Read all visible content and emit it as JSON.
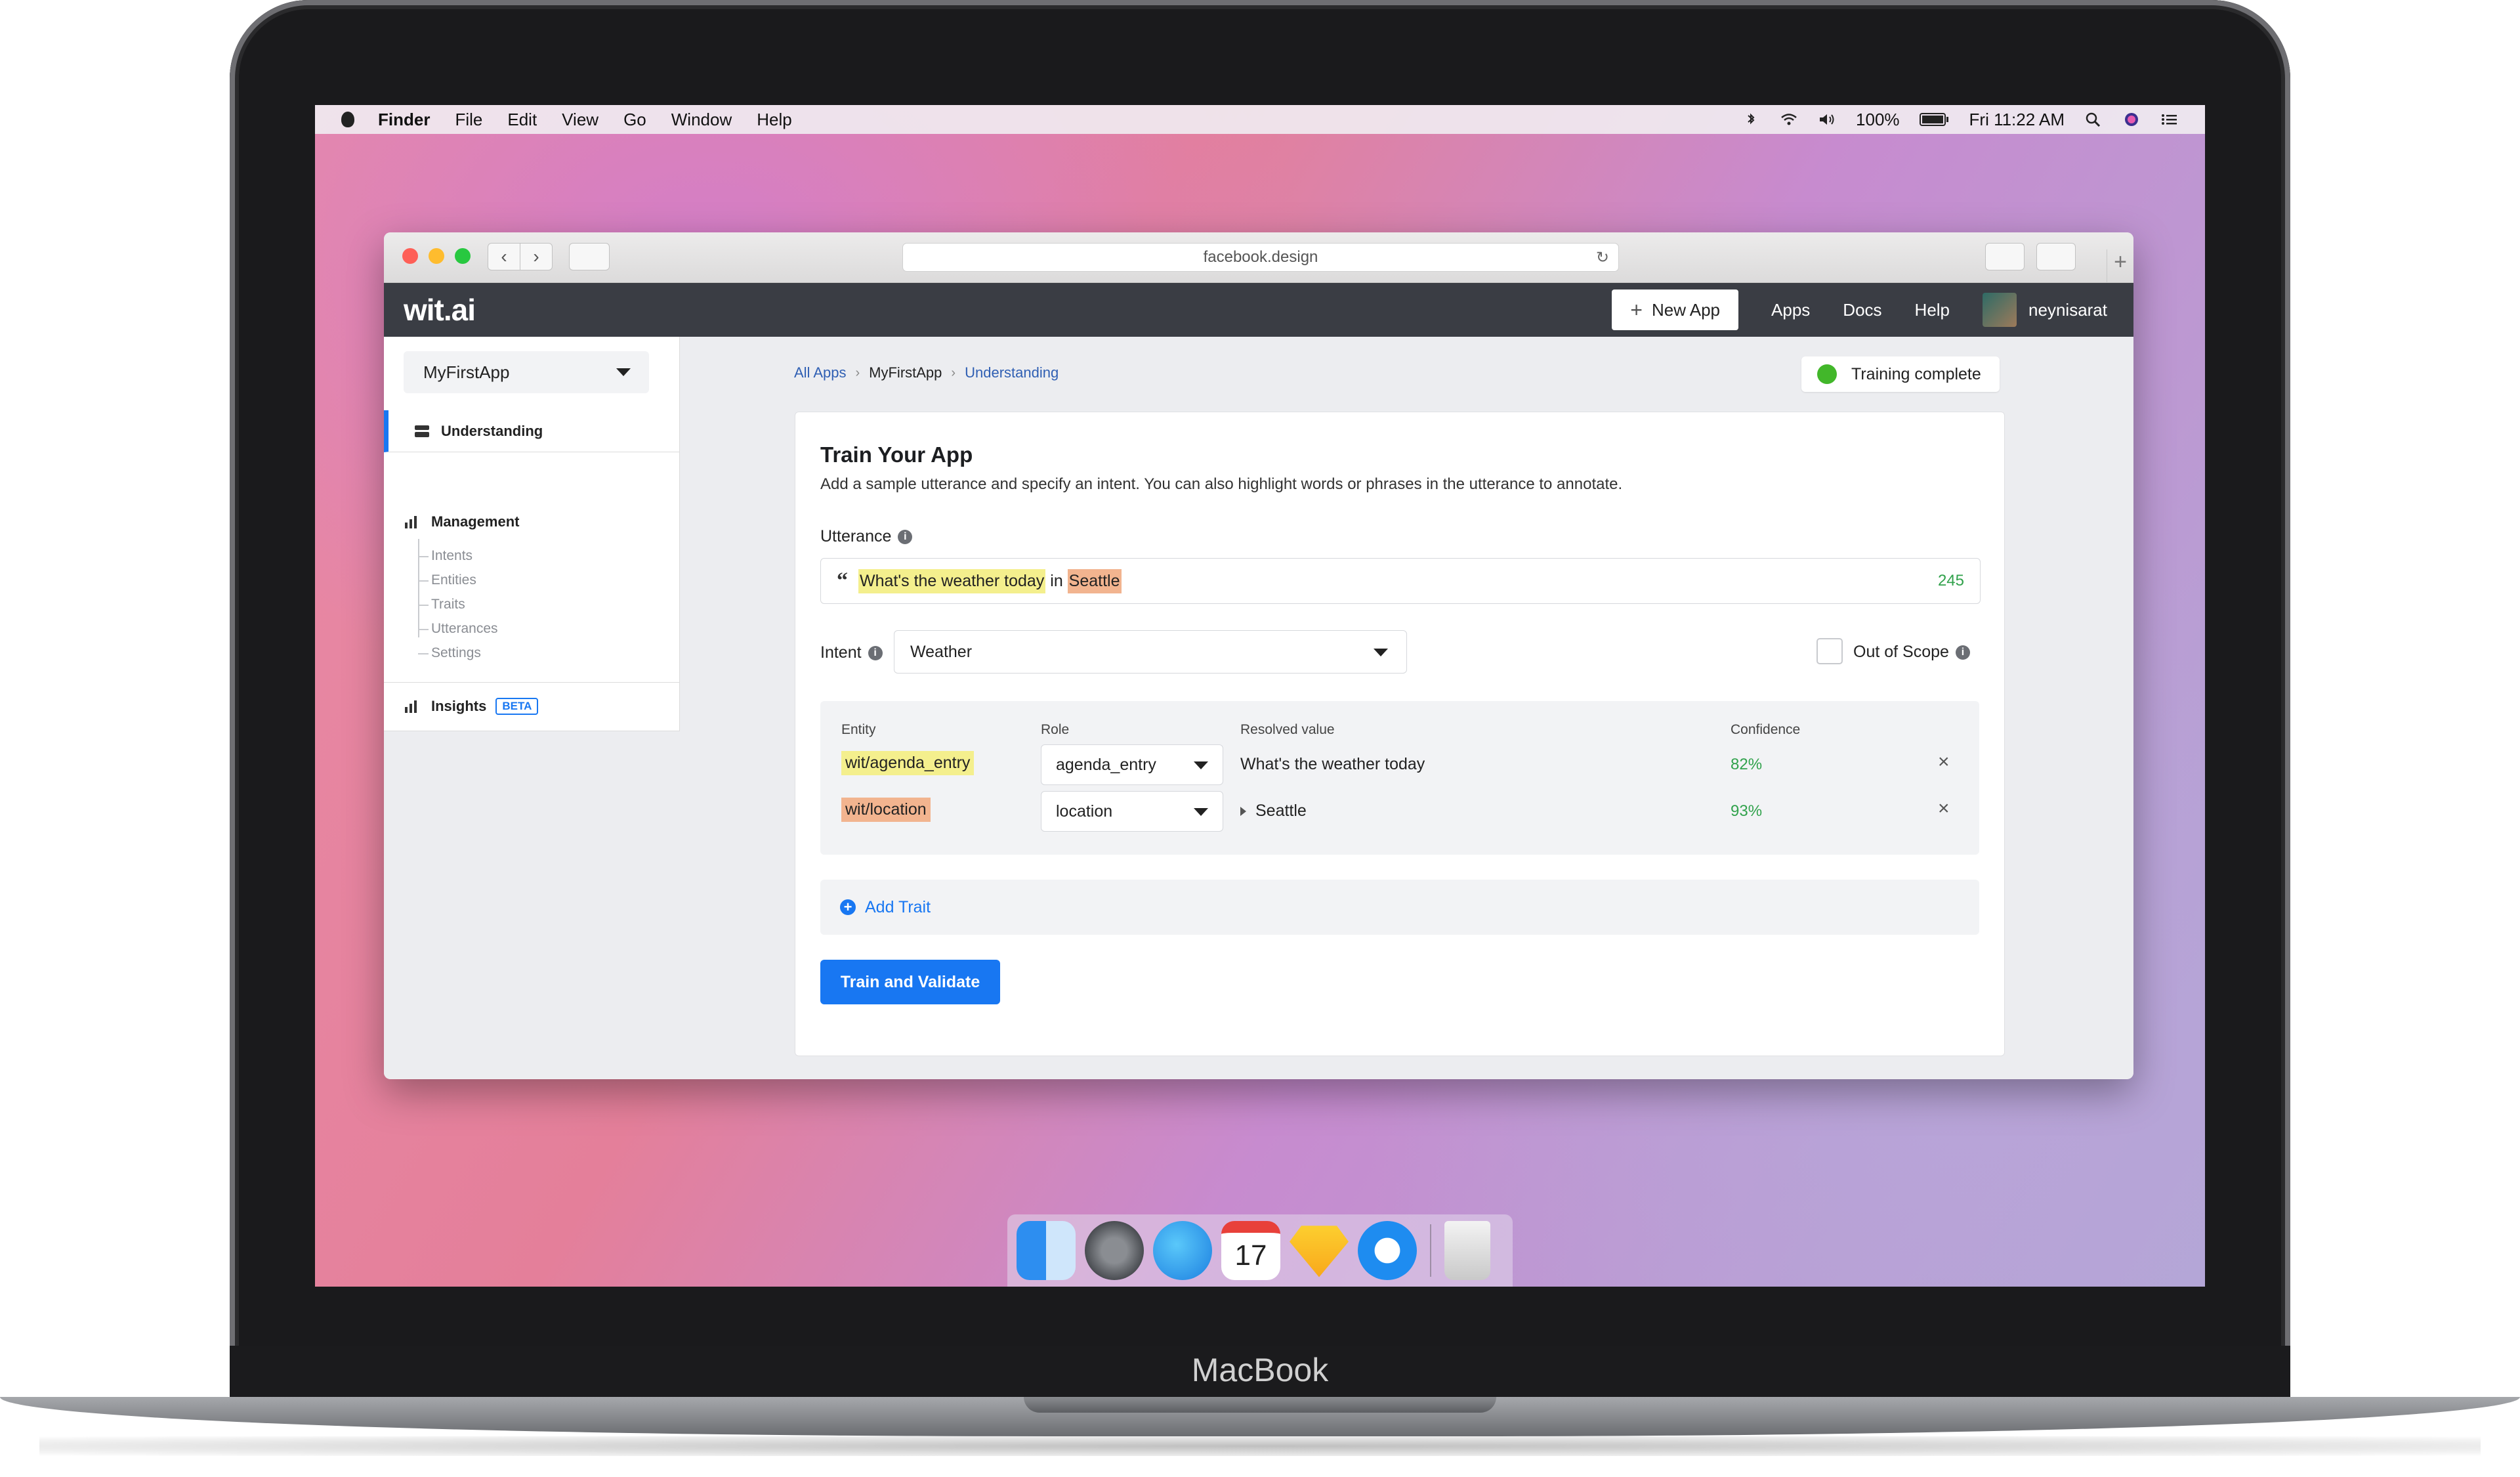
{
  "device": {
    "brand": "MacBook"
  },
  "menubar": {
    "app": "Finder",
    "menus": [
      "File",
      "Edit",
      "View",
      "Go",
      "Window",
      "Help"
    ],
    "battery": "100%",
    "clock": "Fri 11:22 AM"
  },
  "browser": {
    "url": "facebook.design"
  },
  "header": {
    "logo": "wit.ai",
    "new_app": "New App",
    "links": [
      "Apps",
      "Docs",
      "Help"
    ],
    "username": "neynisarat"
  },
  "sidebar": {
    "app_select": "MyFirstApp",
    "understanding": "Understanding",
    "management": "Management",
    "management_items": [
      "Intents",
      "Entities",
      "Traits",
      "Utterances",
      "Settings"
    ],
    "insights": "Insights",
    "beta": "BETA"
  },
  "breadcrumb": {
    "all_apps": "All Apps",
    "app": "MyFirstApp",
    "page": "Understanding"
  },
  "status": {
    "label": "Training complete",
    "color": "#42b72a"
  },
  "train": {
    "title": "Train Your App",
    "description": "Add a sample utterance and specify an intent. You can also highlight words or phrases in the utterance to annotate.",
    "utterance_label": "Utterance",
    "utterance": {
      "part1": "What's the weather today",
      "joiner": " in ",
      "part2": "Seattle"
    },
    "char_count": "245",
    "intent_label": "Intent",
    "intent_value": "Weather",
    "out_of_scope": "Out of Scope",
    "columns": [
      "Entity",
      "Role",
      "Resolved value",
      "Confidence"
    ],
    "entities": [
      {
        "entity": "wit/agenda_entry",
        "role": "agenda_entry",
        "resolved": "What's the weather today",
        "confidence": "82%",
        "highlight": "#f4ef8d"
      },
      {
        "entity": "wit/location",
        "role": "location",
        "resolved": "Seattle",
        "confidence": "93%",
        "highlight": "#f2b48f"
      }
    ],
    "add_trait": "Add Trait",
    "train_button": "Train and Validate"
  },
  "colors": {
    "primary": "#1877f2",
    "header": "#3a3d44",
    "success": "#31a24c"
  },
  "dock": {
    "apps": [
      "finder-icon",
      "system-preferences-icon",
      "messages-icon",
      "calendar-icon",
      "sketch-icon",
      "app-icon",
      "trash-icon"
    ],
    "calendar_day": "17"
  }
}
